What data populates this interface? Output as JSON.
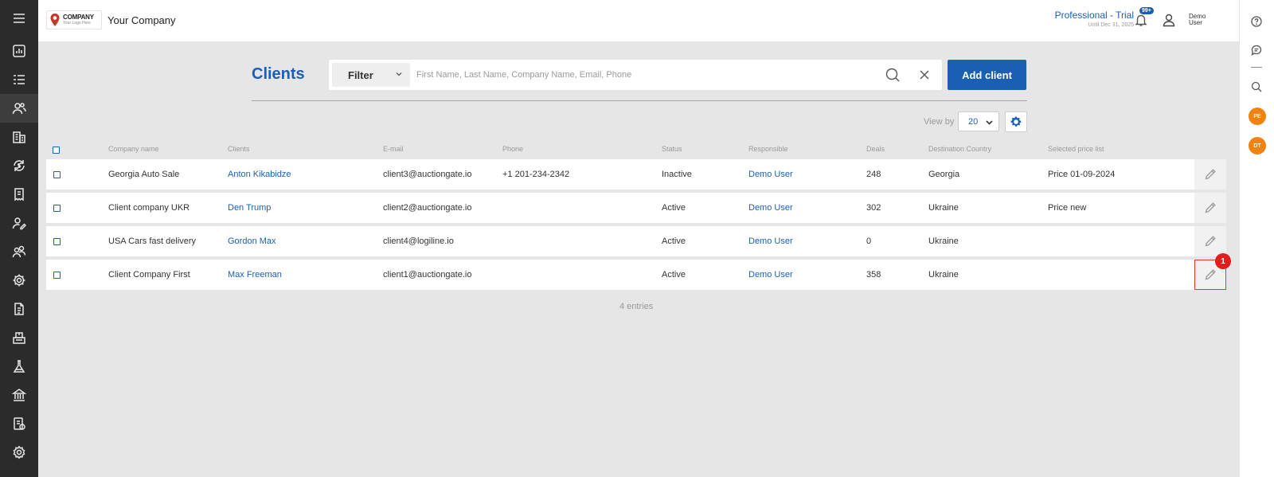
{
  "header": {
    "logo_main": "COMPANY",
    "logo_sub": "Your Logo Here",
    "company_name": "Your Company",
    "plan_title": "Professional - Trial",
    "plan_until": "Until Dec 31, 2025",
    "notifications_badge": "99+",
    "user_name": "Demo User"
  },
  "sidebar": {
    "items": [
      {
        "icon": "menu-icon"
      },
      {
        "icon": "dashboard-icon"
      },
      {
        "icon": "list-icon"
      },
      {
        "icon": "clients-icon",
        "active": true
      },
      {
        "icon": "buildings-icon"
      },
      {
        "icon": "sync-dollar-icon"
      },
      {
        "icon": "receipt-icon"
      },
      {
        "icon": "user-edit-icon"
      },
      {
        "icon": "users-icon"
      },
      {
        "icon": "settings-cog-icon"
      },
      {
        "icon": "document-icon"
      },
      {
        "icon": "warehouse-icon"
      },
      {
        "icon": "lab-icon"
      },
      {
        "icon": "bank-icon"
      },
      {
        "icon": "reports-icon"
      },
      {
        "icon": "settings-icon"
      }
    ]
  },
  "rightbar": {
    "avatars": [
      "PE",
      "DT"
    ]
  },
  "toolbar": {
    "title": "Clients",
    "filter_label": "Filter",
    "search_placeholder": "First Name, Last Name, Company Name, Email, Phone",
    "search_value": "",
    "add_label": "Add client",
    "view_by_label": "View by",
    "view_by_value": "20"
  },
  "table": {
    "columns": [
      "Company name",
      "Clients",
      "E-mail",
      "Phone",
      "Status",
      "Responsible",
      "Deals",
      "Destination Country",
      "Selected price list"
    ],
    "rows": [
      {
        "company": "Georgia Auto Sale",
        "client": "Anton Kikabidze",
        "email": "client3@auctiongate.io",
        "phone": "+1 201-234-2342",
        "status": "Inactive",
        "responsible": "Demo User",
        "deals": "248",
        "country": "Georgia",
        "price_list": "Price 01-09-2024"
      },
      {
        "company": "Client company UKR",
        "client": "Den Trump",
        "email": "client2@auctiongate.io",
        "phone": "",
        "status": "Active",
        "responsible": "Demo User",
        "deals": "302",
        "country": "Ukraine",
        "price_list": "Price new"
      },
      {
        "company": "USA Cars fast delivery",
        "client": "Gordon Max",
        "email": "client4@logiline.io",
        "phone": "",
        "status": "Active",
        "responsible": "Demo User",
        "deals": "0",
        "country": "Ukraine",
        "price_list": ""
      },
      {
        "company": "Client Company First",
        "client": "Max Freeman",
        "email": "client1@auctiongate.io",
        "phone": "",
        "status": "Active",
        "responsible": "Demo User",
        "deals": "358",
        "country": "Ukraine",
        "price_list": ""
      }
    ],
    "entries_text": "4 entries"
  },
  "annotation": {
    "step_badge": "1"
  },
  "colors": {
    "accent": "#1a5fb4",
    "sidebar": "#2b2b2b",
    "avatar": "#f0830f",
    "highlight": "#e0392b"
  }
}
